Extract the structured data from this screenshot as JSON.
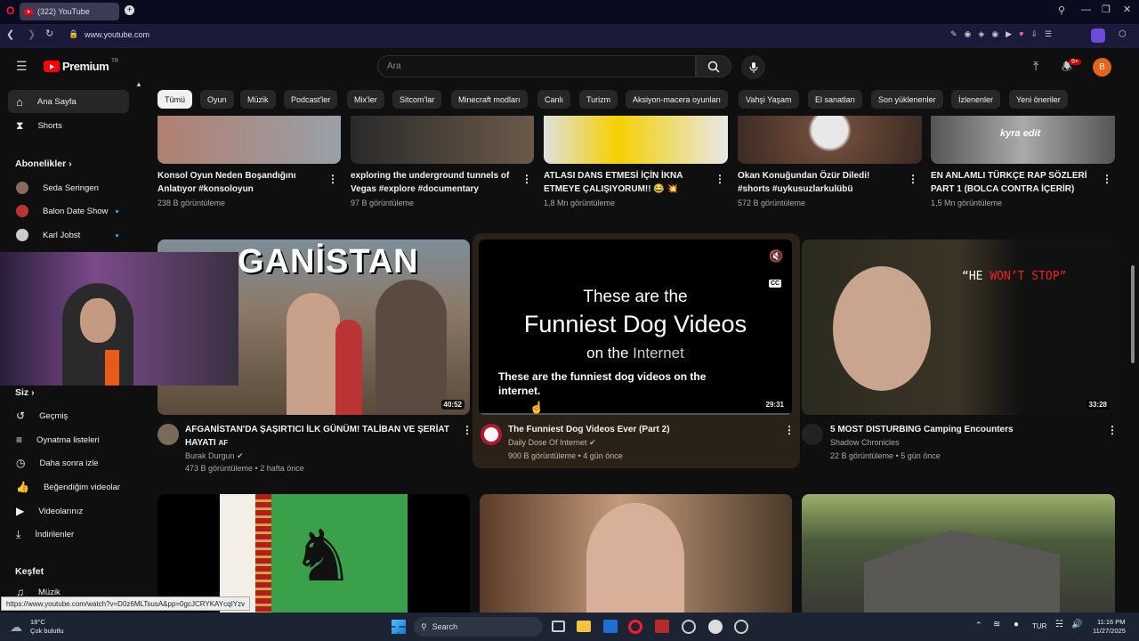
{
  "browser": {
    "tab_title": "(322) YouTube",
    "url": "www.youtube.com"
  },
  "header": {
    "logo_text": "Premium",
    "logo_region": "TR",
    "search_placeholder": "Ara",
    "notification_count": "9+",
    "avatar_letter": "B"
  },
  "sidebar": {
    "home": "Ana Sayfa",
    "shorts": "Shorts",
    "subscriptions_heading": "Abonelikler",
    "subscriptions": [
      {
        "name": "Seda Seringen",
        "new": false
      },
      {
        "name": "Balon Date Show",
        "new": true
      },
      {
        "name": "Karl Jobst",
        "new": true
      }
    ],
    "you_heading": "Siz",
    "you_items": [
      "Geçmiş",
      "Oynatma listeleri",
      "Daha sonra izle",
      "Beğendiğim videolar",
      "Videolarınız",
      "İndirilenler"
    ],
    "explore_heading": "Keşfet",
    "explore_items": [
      "Müzik"
    ]
  },
  "chips": [
    "Tümü",
    "Oyun",
    "Müzik",
    "Podcast'ler",
    "Mix'ler",
    "Sitcom'lar",
    "Minecraft modları",
    "Canlı",
    "Turizm",
    "Aksiyon-macera oyunları",
    "Vahşi Yaşam",
    "El sanatları",
    "Son yüklenenler",
    "İzlenenler",
    "Yeni öneriler"
  ],
  "row1": [
    {
      "title1": "Konsol Oyun Neden Boşandığını",
      "title2": "Anlatıyor  #konsoloyun",
      "views": "238 B görüntüleme"
    },
    {
      "title1": "exploring the underground tunnels of",
      "title2": "Vegas #explore #documentary",
      "views": "97 B görüntüleme"
    },
    {
      "title1": "ATLASI DANS ETMESİ İÇİN İKNA",
      "title2": "ETMEYE ÇALIŞIYORUM!! 😂 💥",
      "views": "1,8 Mn görüntüleme"
    },
    {
      "title1": "Okan Konuğundan Özür Diledi!",
      "title2": "#shorts #uykusuzlarkulübü",
      "views": "572 B görüntüleme"
    },
    {
      "title1": "EN ANLAMLI TÜRKÇE RAP SÖZLERİ",
      "title2": "PART 1 (BOLCA CONTRA İÇERİR)",
      "views": "1,5 Mn görüntüleme",
      "thumb_text": "kyra edit"
    }
  ],
  "row2": [
    {
      "thumb_text": "GANİSTAN",
      "duration": "40:52",
      "title1": "AFGANİSTAN'DA ŞAŞIRTICI İLK GÜNÜM! TALİBAN VE ŞERİAT",
      "title2": "HAYATI",
      "title_suffix": "AF",
      "channel": "Burak Durgun",
      "meta": "473 B görüntüleme • 2 hafta önce"
    },
    {
      "thumb_line1": "These are the",
      "thumb_line2": "Funniest Dog Videos",
      "thumb_line3a": "on the",
      "thumb_line3b": "Internet",
      "caption": "These are the funniest dog videos on the internet.",
      "cc_label": "CC",
      "duration": "29:31",
      "title1": "The Funniest Dog Videos Ever (Part 2)",
      "channel": "Daily Dose Of Internet",
      "meta": "900 B görüntüleme • 4 gün önce"
    },
    {
      "thumb_text_a": "“HE",
      "thumb_text_b": "WON’T STOP”",
      "duration": "33:28",
      "title1": "5 MOST DISTURBING Camping Encounters",
      "channel": "Shadow Chronicles",
      "meta": "22 B görüntüleme • 5 gün önce"
    }
  ],
  "status_url": "https://www.youtube.com/watch?v=D0z6MLTsusA&pp=0gcJCRYKAYcqIYzv",
  "taskbar": {
    "temp": "18°C",
    "weather": "Çok bulutlu",
    "search": "Search",
    "lang": "TUR",
    "time": "11:16 PM",
    "date": "11/27/2025"
  },
  "colors": {
    "accent_red": "#ff0000",
    "link_blue": "#3ea6ff",
    "bg": "#0f0f0f"
  }
}
